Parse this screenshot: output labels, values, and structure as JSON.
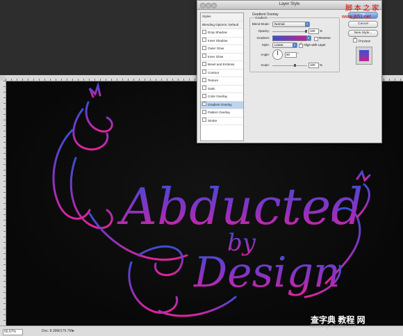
{
  "dialog": {
    "title": "Layer Style",
    "styles_list": [
      {
        "label": "Styles",
        "checkbox": false,
        "checked": false,
        "indent": false,
        "selected": false,
        "header": true
      },
      {
        "label": "Blending Options: Default",
        "checkbox": false,
        "checked": false,
        "indent": false,
        "selected": false,
        "header": true
      },
      {
        "label": "Drop Shadow",
        "checkbox": true,
        "checked": false,
        "indent": false,
        "selected": false
      },
      {
        "label": "Inner Shadow",
        "checkbox": true,
        "checked": false,
        "indent": false,
        "selected": false
      },
      {
        "label": "Outer Glow",
        "checkbox": true,
        "checked": false,
        "indent": false,
        "selected": false
      },
      {
        "label": "Inner Glow",
        "checkbox": true,
        "checked": false,
        "indent": false,
        "selected": false
      },
      {
        "label": "Bevel and Emboss",
        "checkbox": true,
        "checked": false,
        "indent": false,
        "selected": false
      },
      {
        "label": "Contour",
        "checkbox": true,
        "checked": false,
        "indent": true,
        "selected": false
      },
      {
        "label": "Texture",
        "checkbox": true,
        "checked": false,
        "indent": true,
        "selected": false
      },
      {
        "label": "Satin",
        "checkbox": true,
        "checked": false,
        "indent": false,
        "selected": false
      },
      {
        "label": "Color Overlay",
        "checkbox": true,
        "checked": false,
        "indent": false,
        "selected": false
      },
      {
        "label": "Gradient Overlay",
        "checkbox": true,
        "checked": true,
        "indent": false,
        "selected": true
      },
      {
        "label": "Pattern Overlay",
        "checkbox": true,
        "checked": false,
        "indent": false,
        "selected": false
      },
      {
        "label": "Stroke",
        "checkbox": true,
        "checked": false,
        "indent": false,
        "selected": false
      }
    ],
    "panel": {
      "section_title": "Gradient Overlay",
      "group_title": "Gradient",
      "blend_mode_label": "Blend Mode:",
      "blend_mode_value": "Normal",
      "opacity_label": "Opacity:",
      "opacity_value": "100",
      "opacity_fraction": 1.0,
      "percent": "%",
      "gradient_label": "Gradient:",
      "reverse_label": "Reverse",
      "reverse_checked": false,
      "style_label": "Style:",
      "style_value": "Linear",
      "align_label": "Align with Layer",
      "align_checked": true,
      "angle_label": "Angle:",
      "angle_value": "90",
      "angle_unit": "°",
      "scale_label": "Scale:",
      "scale_value": "100",
      "scale_fraction": 0.67
    },
    "buttons": {
      "ok": "OK",
      "cancel": "Cancel",
      "new_style": "New Style..."
    },
    "preview_label": "Preview",
    "preview_checked": true
  },
  "artwork": {
    "line1": "Abducted",
    "line2": "by",
    "line3": "Design",
    "gradient_top_color": "#3a4fd6",
    "gradient_bottom_color": "#e0249b"
  },
  "status_bar": {
    "zoom": "66.67%",
    "doc": "Doc: 8.39M/176.7M"
  },
  "watermarks": {
    "top_line1": "脚 本 之 家",
    "top_line2": "www.jb51.net",
    "bottom_line1": "查字典 教程 网",
    "bottom_line2": "jiaocheng.chazidian.com"
  }
}
